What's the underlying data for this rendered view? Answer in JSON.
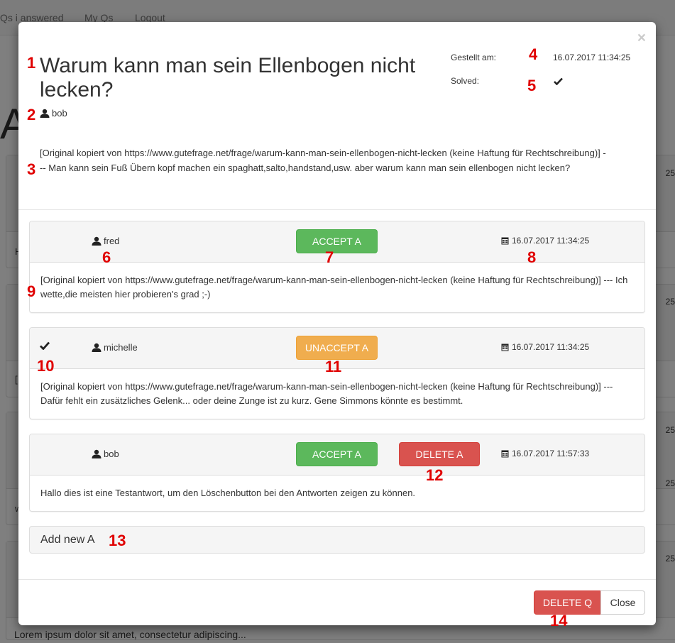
{
  "background": {
    "nav": [
      "Qs i answered",
      "My Qs",
      "Logout"
    ],
    "heading_fragment": "Al",
    "side_dates": [
      "25",
      "25",
      "25",
      "25",
      "25"
    ],
    "card_fragments": [
      "H",
      "[",
      "w"
    ],
    "footer_text": "Lorem ipsum dolor sit amet, consectetur adipiscing..."
  },
  "modal": {
    "close_symbol": "×",
    "question": {
      "title": "Warum kann man sein Ellenbogen nicht lecken?",
      "author": "bob",
      "created_label": "Gestellt am:",
      "created_value": "16.07.2017 11:34:25",
      "solved_label": "Solved:",
      "solved_icon": "check-icon",
      "body": "[Original kopiert von https://www.gutefrage.net/frage/warum-kann-man-sein-ellenbogen-nicht-lecken (keine Haftung für Rechtschreibung)] --- Man kann sein Fuß Übern kopf machen ein spaghatt,salto,handstand,usw. aber warum kann man sein ellenbogen nicht lecken?"
    },
    "answers": [
      {
        "user": "fred",
        "accepted": false,
        "action_label": "ACCEPT A",
        "date": "16.07.2017 11:34:25",
        "body": "[Original kopiert von https://www.gutefrage.net/frage/warum-kann-man-sein-ellenbogen-nicht-lecken (keine Haftung für Rechtschreibung)] --- Ich wette,die meisten hier probieren's grad ;-)"
      },
      {
        "user": "michelle",
        "accepted": true,
        "action_label": "UNACCEPT A",
        "date": "16.07.2017 11:34:25",
        "body": "[Original kopiert von https://www.gutefrage.net/frage/warum-kann-man-sein-ellenbogen-nicht-lecken (keine Haftung für Rechtschreibung)] --- Dafür fehlt ein zusätzliches Gelenk... oder deine Zunge ist zu kurz. Gene Simmons könnte es bestimmt."
      },
      {
        "user": "bob",
        "accepted": false,
        "action_label": "ACCEPT A",
        "delete_label": "DELETE A",
        "date": "16.07.2017 11:57:33",
        "body": "Hallo dies ist eine Testantwort, um den Löschenbutton bei den Antworten zeigen zu können."
      }
    ],
    "add_answer_label": "Add new A",
    "footer": {
      "delete_q_label": "DELETE Q",
      "close_label": "Close"
    }
  },
  "annotations": [
    "1",
    "2",
    "3",
    "4",
    "5",
    "6",
    "7",
    "8",
    "9",
    "10",
    "11",
    "12",
    "13",
    "14"
  ],
  "colors": {
    "success": "#5cb85c",
    "warning": "#f0ad4e",
    "danger": "#d9534f",
    "annotation": "#e00000"
  }
}
